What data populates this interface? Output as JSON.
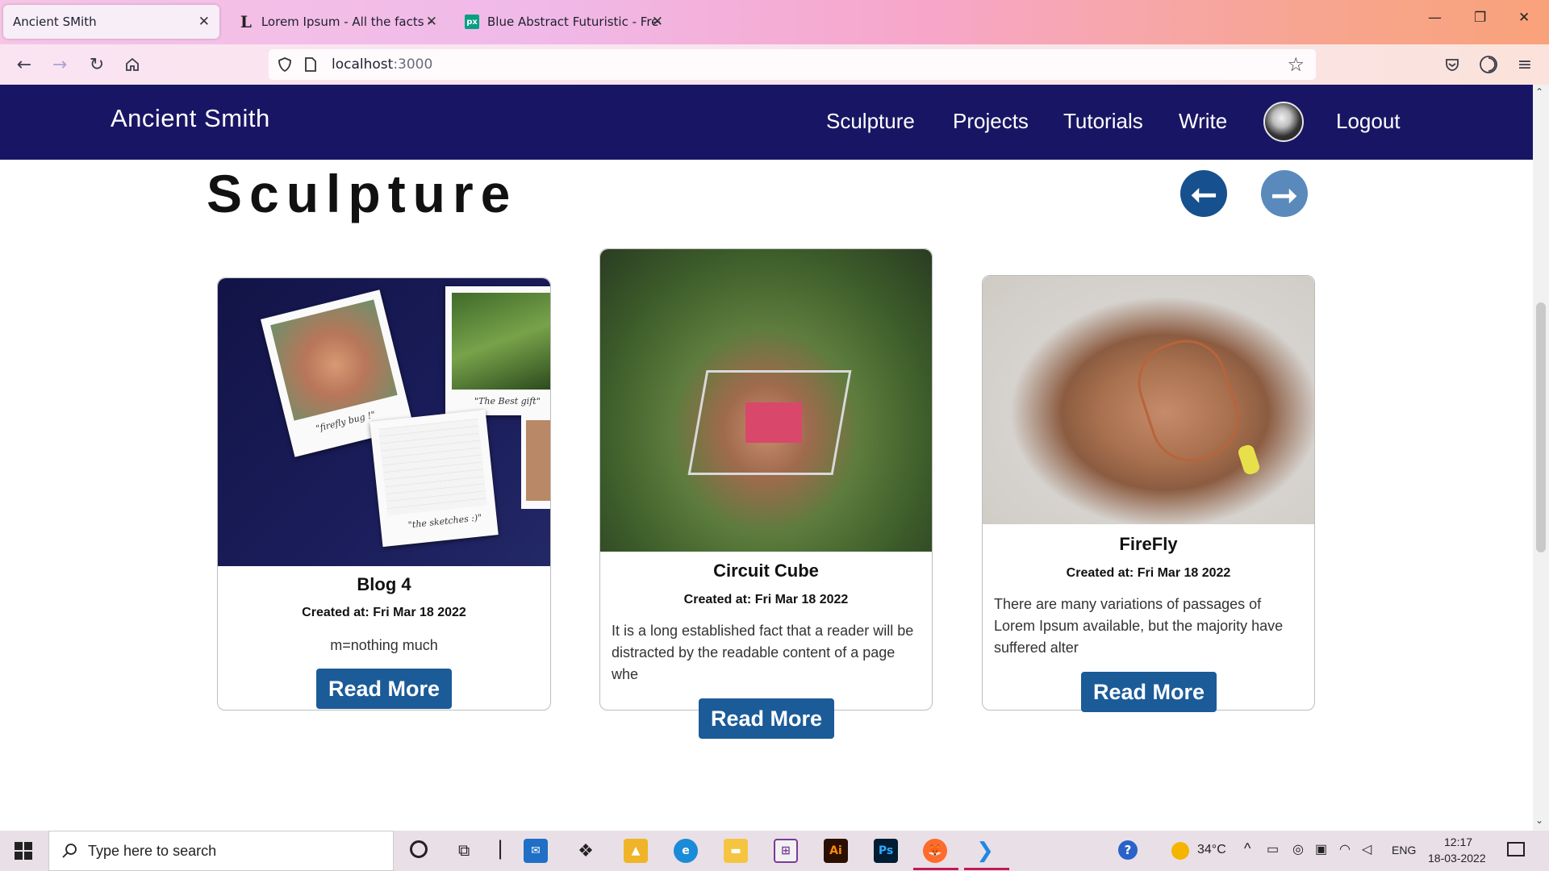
{
  "browser": {
    "tabs": [
      {
        "title": "Ancient SMith",
        "icon": "none"
      },
      {
        "title": "Lorem Ipsum - All the facts - Lip",
        "icon": "lipsum-favicon"
      },
      {
        "title": "Blue Abstract Futuristic - Free v",
        "icon": "pexels-favicon"
      }
    ],
    "url_host": "localhost",
    "url_port": ":3000",
    "window_controls": {
      "minimize": "—",
      "restore": "❐",
      "close": "✕"
    }
  },
  "site": {
    "brand": "Ancient Smith",
    "nav": [
      "Sculpture",
      "Projects",
      "Tutorials",
      "Write"
    ],
    "logout": "Logout",
    "header_color": "#181664"
  },
  "page": {
    "title": "Sculpture",
    "prev_icon": "arrow-left-icon",
    "next_icon": "arrow-right-icon"
  },
  "cards": [
    {
      "title": "Blog 4",
      "date": "Created at: Fri Mar 18 2022",
      "text": "m=nothing much",
      "button": "Read More",
      "photo_captions": [
        "\"firefly bug !\"",
        "\"The Best gift\"",
        "\"the sketches :)\""
      ]
    },
    {
      "title": "Circuit Cube",
      "date": "Created at: Fri Mar 18 2022",
      "text": "It is a long established fact that a reader will be distracted by the readable content of a page whe",
      "button": "Read More"
    },
    {
      "title": "FireFly",
      "date": "Created at: Fri Mar 18 2022",
      "text": "There are many variations of passages of Lorem Ipsum available, but the majority have suffered alter",
      "button": "Read More"
    }
  ],
  "taskbar": {
    "search_placeholder": "Type here to search",
    "temperature": "34°C",
    "language": "ENG",
    "time": "12:17",
    "date": "18-03-2022"
  },
  "colors": {
    "button": "#1b5b98",
    "arrow_prev": "#17508e",
    "arrow_next": "#5a89bc"
  }
}
